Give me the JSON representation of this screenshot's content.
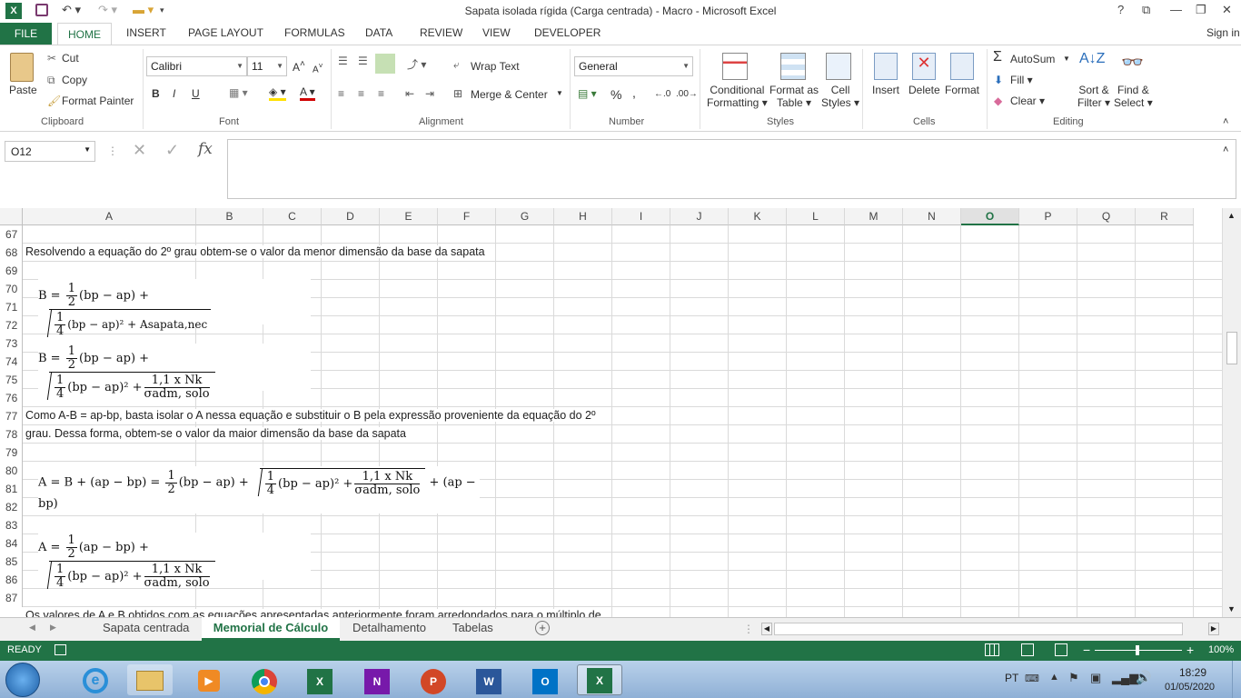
{
  "window": {
    "title": "Sapata isolada rígida (Carga centrada) - Macro - Microsoft Excel",
    "sign_in": "Sign in",
    "controls": [
      "?",
      "⧉",
      "—",
      "❐",
      "✕"
    ]
  },
  "ribbon_tabs": [
    "FILE",
    "HOME",
    "INSERT",
    "PAGE LAYOUT",
    "FORMULAS",
    "DATA",
    "REVIEW",
    "VIEW",
    "DEVELOPER"
  ],
  "clipboard": {
    "paste": "Paste",
    "cut": "Cut",
    "copy": "Copy",
    "format_painter": "Format Painter",
    "label": "Clipboard"
  },
  "font": {
    "name": "Calibri",
    "size": "11",
    "bold": "B",
    "italic": "I",
    "underline": "U",
    "label": "Font"
  },
  "alignment": {
    "wrap": "Wrap Text",
    "merge": "Merge & Center",
    "label": "Alignment"
  },
  "number": {
    "format": "General",
    "percent": "%",
    "comma": ",",
    "label": "Number"
  },
  "styles": {
    "conditional": "Conditional",
    "conditional2": "Formatting",
    "format_as": "Format as",
    "format_as2": "Table",
    "cell": "Cell",
    "cell2": "Styles",
    "label": "Styles"
  },
  "cells": {
    "insert": "Insert",
    "delete": "Delete",
    "format": "Format",
    "label": "Cells"
  },
  "editing": {
    "autosum": "AutoSum",
    "fill": "Fill",
    "clear": "Clear",
    "sort": "Sort &",
    "sort2": "Filter",
    "find": "Find &",
    "find2": "Select",
    "label": "Editing"
  },
  "formula_bar": {
    "name_box": "O12",
    "fx": "fx",
    "value": ""
  },
  "columns": [
    "A",
    "B",
    "C",
    "D",
    "E",
    "F",
    "G",
    "H",
    "I",
    "J",
    "K",
    "L",
    "M",
    "N",
    "O",
    "P",
    "Q",
    "R"
  ],
  "selected_column": "O",
  "rows": [
    "67",
    "68",
    "69",
    "70",
    "71",
    "72",
    "73",
    "74",
    "75",
    "76",
    "77",
    "78",
    "79",
    "80",
    "81",
    "82",
    "83",
    "84",
    "85",
    "86",
    "87"
  ],
  "texts": {
    "r68": "Resolvendo a equação do 2º grau obtem-se o valor da menor dimensão da base da sapata",
    "r77": "Como A-B = ap-bp, basta isolar o A nessa equação e substituir o B pela expressão proveniente da equação do 2º",
    "r78": "grau. Dessa forma, obtem-se o valor da maior dimensão da base da sapata",
    "r88": "Os valores de A e B obtidos com as equações apresentadas anteriormente foram arredondados para o múltiplo de"
  },
  "equations": {
    "eq1": {
      "lhs": "B = ",
      "half": "1",
      "two": "2",
      "term": "(bp − ap) +",
      "q1": "1",
      "q4": "4",
      "inner": "(bp − ap)² + Asapata,nec"
    },
    "eq2": {
      "lhs": "B = ",
      "half": "1",
      "two": "2",
      "term": "(bp − ap) +",
      "q1": "1",
      "q4": "4",
      "inner": "(bp − ap)² +",
      "fnum": "1,1 x Nk",
      "fden": "σadm, solo"
    },
    "eq3": {
      "lhs": "A = B + (ap − bp) = ",
      "half": "1",
      "two": "2",
      "term": "(bp − ap) +",
      "q1": "1",
      "q4": "4",
      "inner": "(bp − ap)² +",
      "fnum": "1,1 x Nk",
      "fden": "σadm, solo",
      "tail": "+ (ap − bp)"
    },
    "eq4": {
      "lhs": "A = ",
      "half": "1",
      "two": "2",
      "term": "(ap − bp) +",
      "q1": "1",
      "q4": "4",
      "inner": "(bp − ap)² +",
      "fnum": "1,1 x Nk",
      "fden": "σadm, solo"
    }
  },
  "sheets": [
    "Sapata centrada",
    "Memorial de Cálculo",
    "Detalhamento",
    "Tabelas"
  ],
  "active_sheet": "Memorial de Cálculo",
  "status": {
    "state": "READY",
    "zoom": "100%"
  },
  "taskbar": {
    "lang": "PT",
    "time": "18:29",
    "date": "01/05/2020"
  },
  "colors": {
    "excel_green": "#217346"
  }
}
